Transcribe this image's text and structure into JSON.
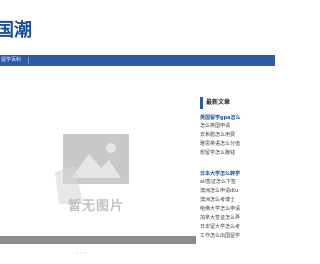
{
  "header": {
    "logo_text": "国潮"
  },
  "nav": {
    "item_label": "留学百科"
  },
  "banner": {
    "placeholder_text": "暂无图片",
    "dot_count": 4
  },
  "sidebar": {
    "heading": "最新文章",
    "group1": {
      "title": "英国留学gpa怎么",
      "links": [
        "怎么英国申请",
        "去希腊怎么用费",
        "雅思英语怎么分值",
        "想留学怎么赚钱"
      ]
    },
    "group2": {
      "title": "日本大学怎么转学",
      "links": [
        "ali签证怎么下签",
        "澳洲怎么申请dtu",
        "澳洲怎么考博士",
        "哈佛大学怎么申请",
        "加拿大签证怎么弄",
        "日本留大学怎么考",
        "工作怎么出国留学"
      ]
    }
  },
  "colors": {
    "brand_blue": "#2d5aa8",
    "logo_blue": "#1a4f9e",
    "banner_bar": "#8a8a8a"
  }
}
